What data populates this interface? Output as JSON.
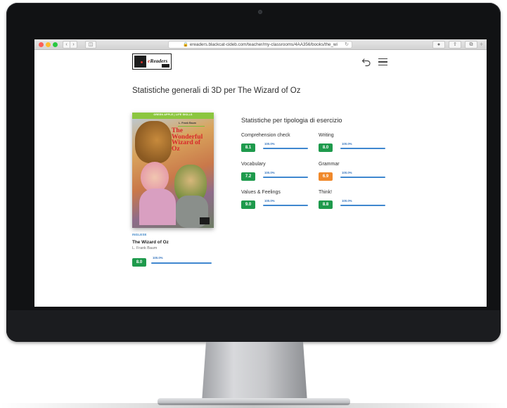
{
  "browser": {
    "url": "ereaders.blackcat-cideb.com/teacher/my-classrooms/4AA356/books/the_wi"
  },
  "header": {
    "logo_text_e": "e",
    "logo_text_rest": "Readers"
  },
  "page": {
    "title": "Statistiche generali di 3D per The Wizard of Oz"
  },
  "book": {
    "cover_band": "GREEN APPLE  |  LIFE SKILLS",
    "cover_author": "L. Frank Baum",
    "cover_title": "The Wonderful Wizard of Oz",
    "language": "INGLESE",
    "title": "The Wizard of Oz",
    "author": "L. Frank Baum",
    "score": "8.0",
    "percent": "100.0%",
    "percent_value": 100
  },
  "stats": {
    "heading": "Statistiche per tipologia di esercizio",
    "exercises": [
      {
        "label": "Comprehension check",
        "score": "8.1",
        "percent": "100.0%",
        "percent_value": 100,
        "color": "#1e9a4c"
      },
      {
        "label": "Writing",
        "score": "8.0",
        "percent": "100.0%",
        "percent_value": 100,
        "color": "#1e9a4c"
      },
      {
        "label": "Vocabulary",
        "score": "7.2",
        "percent": "100.0%",
        "percent_value": 100,
        "color": "#1e9a4c"
      },
      {
        "label": "Grammar",
        "score": "6.9",
        "percent": "100.0%",
        "percent_value": 100,
        "color": "#f0892b"
      },
      {
        "label": "Values & Feelings",
        "score": "9.0",
        "percent": "100.0%",
        "percent_value": 100,
        "color": "#1e9a4c"
      },
      {
        "label": "Think!",
        "score": "8.8",
        "percent": "100.0%",
        "percent_value": 100,
        "color": "#1e9a4c"
      }
    ]
  },
  "colors": {
    "score_green": "#1e9a4c",
    "score_orange": "#f0892b",
    "progress_blue": "#3f87cf"
  },
  "icons": {
    "back": "undo-arrow-icon",
    "menu": "hamburger-menu-icon"
  }
}
